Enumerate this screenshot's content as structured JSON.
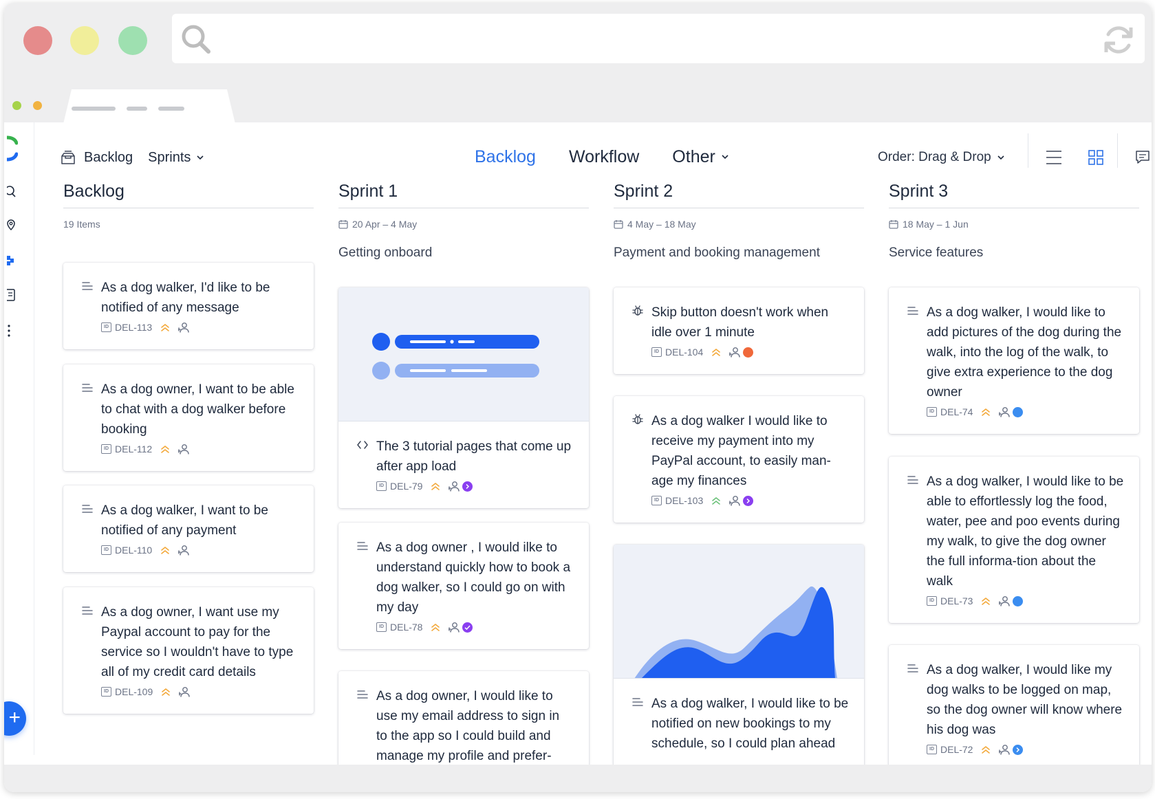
{
  "nav": {
    "left": {
      "backlog": "Backlog",
      "sprints": "Sprints"
    },
    "tabs": [
      {
        "label": "Backlog",
        "active": true
      },
      {
        "label": "Workflow",
        "active": false
      },
      {
        "label": "Other",
        "active": false
      }
    ],
    "order": "Order: Drag & Drop"
  },
  "colors": {
    "accent": "#2f73e8",
    "prio_orange": "#f3a93a",
    "prio_green": "#6cc27a",
    "status_orange": "#f0683a",
    "status_purple": "#8a3ff0",
    "status_blue": "#3b8df0"
  },
  "columns": [
    {
      "title": "Backlog",
      "meta": "19 Items",
      "cards": [
        {
          "icon": "story-icon",
          "text": "As a dog walker, I'd like to be notified of any message",
          "id": "DEL-113"
        },
        {
          "icon": "story-icon",
          "text": "As a dog owner, I want to be able to chat with a dog walker before booking",
          "id": "DEL-112"
        },
        {
          "icon": "story-icon",
          "text": "As a dog walker, I want to be notified of any payment",
          "id": "DEL-110"
        },
        {
          "icon": "story-icon",
          "text": "As a dog owner, I want use my Paypal account to pay for the service so I wouldn't have to type all of my credit card details",
          "id": "DEL-109"
        }
      ]
    },
    {
      "title": "Sprint 1",
      "meta": "20 Apr – 4 May",
      "subtitle": "Getting onboard",
      "cards": [
        {
          "icon": "code-icon",
          "text": "The 3 tutorial pages that come up after app load",
          "id": "DEL-79"
        },
        {
          "icon": "story-icon",
          "text": "As a dog owner , I would ilke to understand quickly how to book a dog walker, so I could go on with my day",
          "id": "DEL-78"
        },
        {
          "icon": "story-icon",
          "text": "As a dog owner, I would like to use my email address to sign in to the app so I could build and manage my profile and prefer-",
          "id": ""
        }
      ]
    },
    {
      "title": "Sprint 2",
      "meta": "4 May – 18 May",
      "subtitle": "Payment and booking management",
      "cards": [
        {
          "icon": "bug-icon",
          "text": "Skip button doesn't work when idle over 1 minute",
          "id": "DEL-104"
        },
        {
          "icon": "bug-icon",
          "text": "As a dog walker I would like to receive my payment into my PayPal account, to easily man-age my finances",
          "id": "DEL-103"
        },
        {
          "icon": "story-icon",
          "text": "As a dog walker, I would like to be notified on new bookings to my schedule, so I could plan ahead",
          "id": ""
        }
      ]
    },
    {
      "title": "Sprint 3",
      "meta": "18 May – 1 Jun",
      "subtitle": "Service features",
      "cards": [
        {
          "icon": "story-icon",
          "text": "As a dog walker, I would like to add pictures of the dog during the walk, into the log of the walk, to give extra experience to the dog owner",
          "id": "DEL-74"
        },
        {
          "icon": "story-icon",
          "text": "As a dog walker, I would like to be able to effortlessly log the food, water, pee and poo events during my walk, to give the dog owner the full informa-tion about the walk",
          "id": "DEL-73"
        },
        {
          "icon": "story-icon",
          "text": "As a dog walker, I would like my dog walks to be logged on map, so the dog owner will know where his dog was",
          "id": "DEL-72"
        }
      ]
    }
  ]
}
